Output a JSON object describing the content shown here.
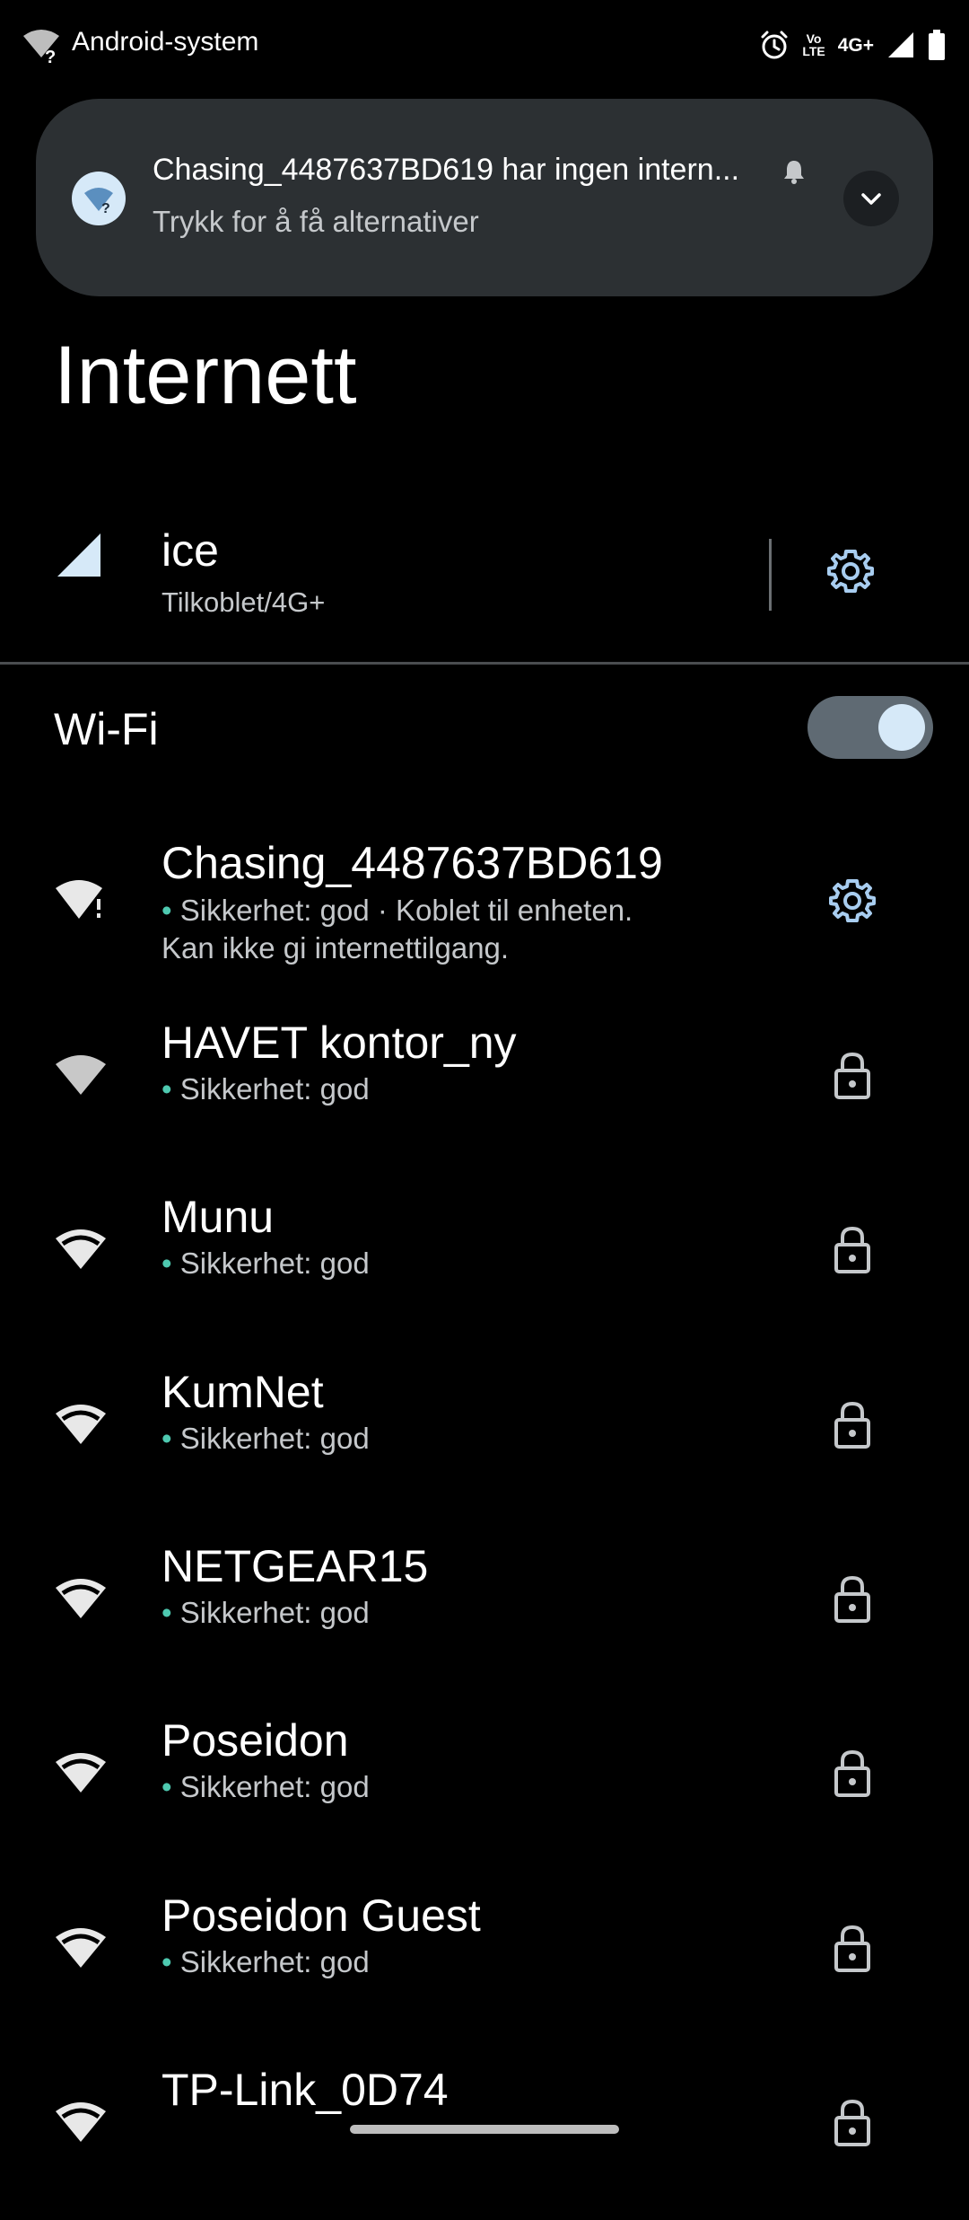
{
  "status_bar": {
    "app_name": "Android-system",
    "network_type": "4G+",
    "volte_top": "Vo",
    "volte_bottom": "LTE"
  },
  "notification": {
    "title": "Chasing_4487637BD619 har ingen intern...",
    "text": "Trykk for å få alternativer"
  },
  "page": {
    "title": "Internett"
  },
  "mobile_network": {
    "name": "ice",
    "status": "Tilkoblet/4G+"
  },
  "wifi": {
    "label": "Wi-Fi",
    "enabled": true
  },
  "networks": [
    {
      "name": "Chasing_4487637BD619",
      "security": "Sikkerhet: god · Koblet til enheten.",
      "detail": "Kan ikke gi internettilgang.",
      "connected": true
    },
    {
      "name": "HAVET kontor_ny",
      "security": "Sikkerhet: god"
    },
    {
      "name": "Munu",
      "security": "Sikkerhet: god"
    },
    {
      "name": "KumNet",
      "security": "Sikkerhet: god"
    },
    {
      "name": "NETGEAR15",
      "security": "Sikkerhet: god"
    },
    {
      "name": "Poseidon",
      "security": "Sikkerhet: god"
    },
    {
      "name": "Poseidon Guest",
      "security": "Sikkerhet: god"
    },
    {
      "name": "TP-Link_0D74",
      "security": ""
    }
  ],
  "colors": {
    "background": "#000000",
    "notification_bg": "#2c3033",
    "accent": "#a8cdf0",
    "secure_dot": "#4ec9b0"
  }
}
